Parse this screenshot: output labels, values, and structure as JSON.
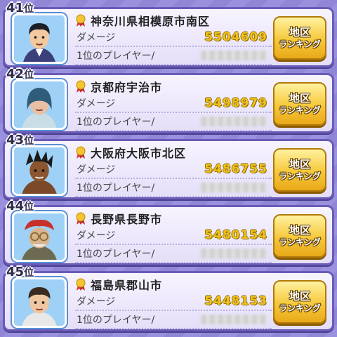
{
  "ui": {
    "damage_label": "ダメージ",
    "player_label": "1位のプレイヤー/",
    "button_line1": "地区",
    "button_line2": "ランキング",
    "rank_suffix": "位"
  },
  "entries": [
    {
      "rank": "41",
      "area": "神奈川県相模原市南区",
      "damage": "5504609"
    },
    {
      "rank": "42",
      "area": "京都府宇治市",
      "damage": "5498979"
    },
    {
      "rank": "43",
      "area": "大阪府大阪市北区",
      "damage": "5486755"
    },
    {
      "rank": "44",
      "area": "長野県長野市",
      "damage": "5480154"
    },
    {
      "rank": "45",
      "area": "福島県郡山市",
      "damage": "5448153"
    }
  ]
}
